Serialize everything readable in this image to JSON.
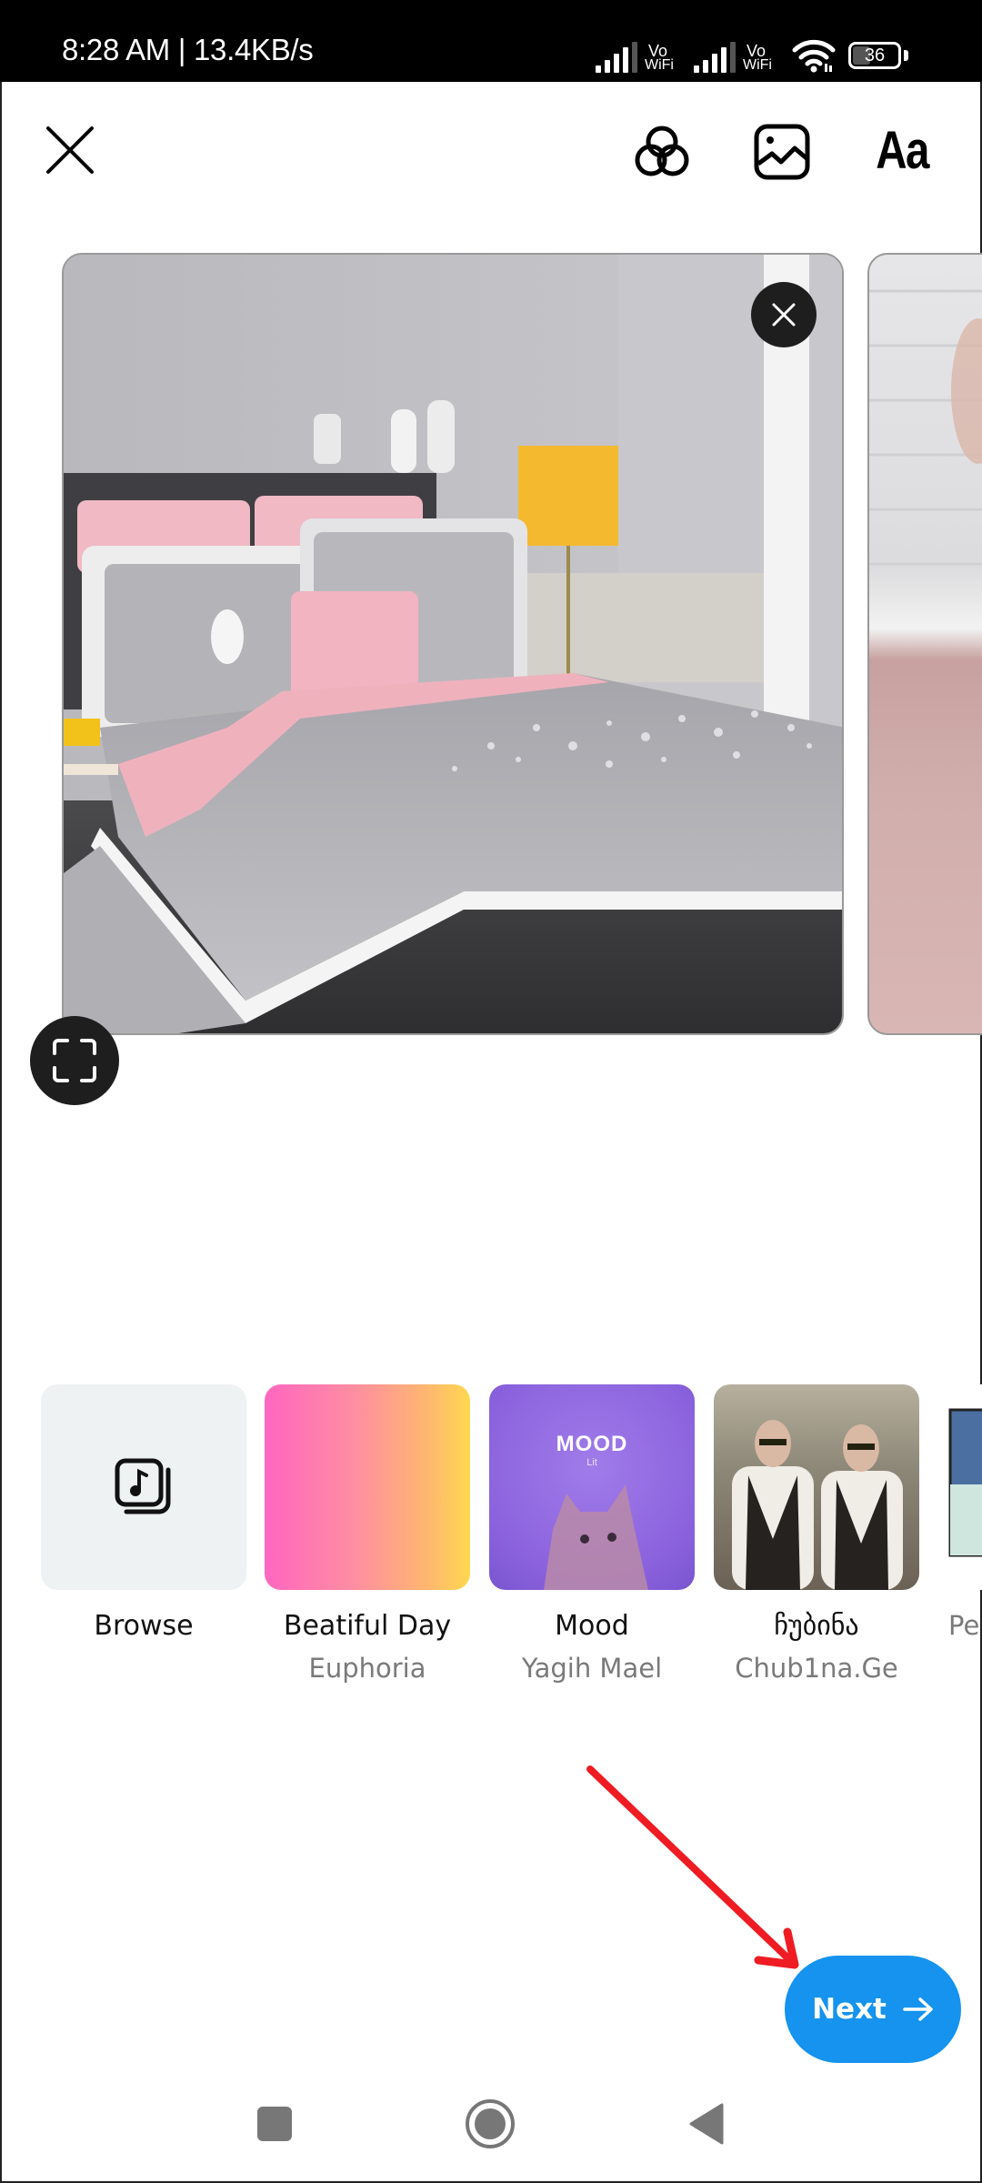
{
  "status_bar": {
    "time_speed": "8:28 AM | 13.4KB/s",
    "sim1_label_top": "Vo",
    "sim1_label_bottom": "WiFi",
    "sim2_label_top": "Vo",
    "sim2_label_bottom": "WiFi",
    "battery_percent": "36",
    "battery_level": 0.36,
    "icons": [
      "signal-icon",
      "vowifi-icon",
      "signal-icon",
      "vowifi-icon",
      "wifi-icon",
      "battery-icon"
    ]
  },
  "toolbar": {
    "close_icon": "close-icon",
    "effects_icon": "effects-icon",
    "image_icon": "image-icon",
    "text_label": "Aa"
  },
  "preview": {
    "remove_icon": "close-icon",
    "fullscreen_icon": "fullscreen-icon",
    "cards": [
      {
        "subject": "bedroom-photo"
      },
      {
        "subject": "pink-bed-photo"
      }
    ]
  },
  "music": {
    "items": [
      {
        "title": "Browse",
        "artist": "",
        "icon": "music-library-icon"
      },
      {
        "title": "Beatiful Day",
        "artist": "Euphoria"
      },
      {
        "title": "Mood",
        "artist": "Yagih Mael",
        "cover_text": "MOOD",
        "cover_subtext": "Lit"
      },
      {
        "title": "ჩუბინა",
        "artist": "Chub1na.Ge"
      },
      {
        "title": "",
        "artist": "Pe"
      }
    ]
  },
  "next_button": {
    "label": "Next",
    "icon": "arrow-right-icon",
    "color": "#1593ee"
  },
  "annotation": {
    "color": "#ef1c24"
  },
  "nav_bar": {
    "icons": [
      "recents-icon",
      "home-icon",
      "back-icon"
    ]
  }
}
